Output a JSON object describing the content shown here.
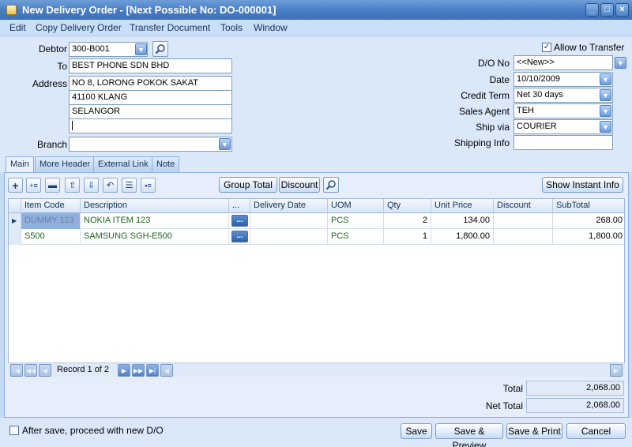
{
  "window": {
    "title": "New Delivery Order - [Next Possible No: DO-000001]",
    "minimize": "_",
    "maximize": "□",
    "close": "×"
  },
  "menu": [
    "Edit",
    "Copy Delivery Order",
    "Transfer Document",
    "Tools",
    "Window"
  ],
  "header": {
    "debtor_label": "Debtor",
    "debtor_value": "300-B001",
    "to_label": "To",
    "to_value": "BEST PHONE SDN BHD",
    "address_label": "Address",
    "address_lines": [
      "NO 8, LORONG POKOK SAKAT",
      "41100 KLANG",
      "SELANGOR",
      ""
    ],
    "branch_label": "Branch",
    "branch_value": "",
    "allow_transfer_label": "Allow to Transfer",
    "allow_transfer_checked": "✓",
    "do_no_label": "D/O No",
    "do_no_value": "<<New>>",
    "date_label": "Date",
    "date_value": "10/10/2009",
    "credit_term_label": "Credit Term",
    "credit_term_value": "Net 30 days",
    "sales_agent_label": "Sales Agent",
    "sales_agent_value": "TEH",
    "ship_via_label": "Ship via",
    "ship_via_value": "COURIER",
    "shipping_info_label": "Shipping Info",
    "shipping_info_value": ""
  },
  "tabs": [
    "Main",
    "More Header",
    "External Link",
    "Note"
  ],
  "toolbar": {
    "group_total": "Group Total",
    "discount": "Discount",
    "show_instant_info": "Show Instant Info"
  },
  "grid": {
    "columns": [
      "Item Code",
      "Description",
      "...",
      "Delivery Date",
      "UOM",
      "Qty",
      "Unit Price",
      "Discount",
      "SubTotal"
    ],
    "rows": [
      {
        "item_code": "DUMMY 123",
        "description": "NOKIA ITEM 123",
        "ellipsis": "...",
        "delivery_date": "",
        "uom": "PCS",
        "qty": "2",
        "unit_price": "134.00",
        "discount": "",
        "subtotal": "268.00"
      },
      {
        "item_code": "S500",
        "description": "SAMSUNG SGH-E500",
        "ellipsis": "...",
        "delivery_date": "",
        "uom": "PCS",
        "qty": "1",
        "unit_price": "1,800.00",
        "discount": "",
        "subtotal": "1,800.00"
      }
    ]
  },
  "navigator": {
    "record_text": "Record 1 of 2"
  },
  "totals": {
    "total_label": "Total",
    "total_value": "2,068.00",
    "net_total_label": "Net Total",
    "net_total_value": "2,068.00"
  },
  "footer": {
    "after_save_label": "After save, proceed with new D/O",
    "save": "Save",
    "save_preview": "Save & Preview",
    "save_print": "Save & Print",
    "cancel": "Cancel"
  }
}
